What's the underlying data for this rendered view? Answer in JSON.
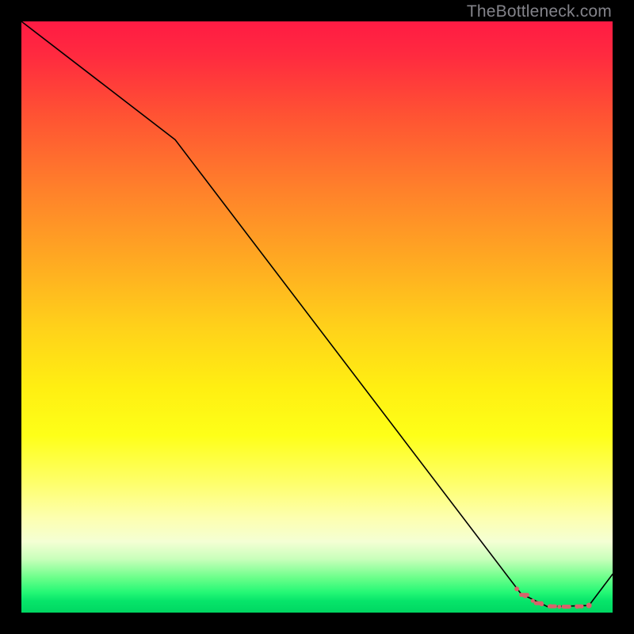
{
  "watermark": "TheBottleneck.com",
  "chart_data": {
    "type": "line",
    "title": "",
    "xlabel": "",
    "ylabel": "",
    "xlim": [
      0,
      100
    ],
    "ylim": [
      0,
      100
    ],
    "series": [
      {
        "name": "curve",
        "x": [
          0,
          26,
          84.5,
          89,
          96,
          100
        ],
        "values": [
          100,
          80,
          3.2,
          1.0,
          1.2,
          6.5
        ]
      }
    ],
    "markers": {
      "name": "dashed-region",
      "color": "#d6646b",
      "x": [
        83.8,
        85.2,
        86.5,
        88.0,
        89.5,
        91.0,
        92.5,
        94.0,
        96.0
      ],
      "y": [
        4.0,
        2.8,
        2.0,
        1.4,
        1.1,
        1.0,
        1.0,
        1.0,
        1.2
      ],
      "r": [
        3.0,
        2.8,
        2.6,
        2.6,
        2.6,
        2.6,
        2.6,
        2.6,
        3.5
      ]
    },
    "marker_bars": {
      "name": "dashed-region-flat",
      "color": "#d6646b",
      "segments": [
        {
          "x0": 84.2,
          "x1": 85.9,
          "y": 3.0
        },
        {
          "x0": 86.7,
          "x1": 88.3,
          "y": 1.6
        },
        {
          "x0": 89.0,
          "x1": 90.6,
          "y": 1.05
        },
        {
          "x0": 91.4,
          "x1": 93.0,
          "y": 1.0
        },
        {
          "x0": 93.6,
          "x1": 95.1,
          "y": 1.05
        }
      ]
    }
  }
}
